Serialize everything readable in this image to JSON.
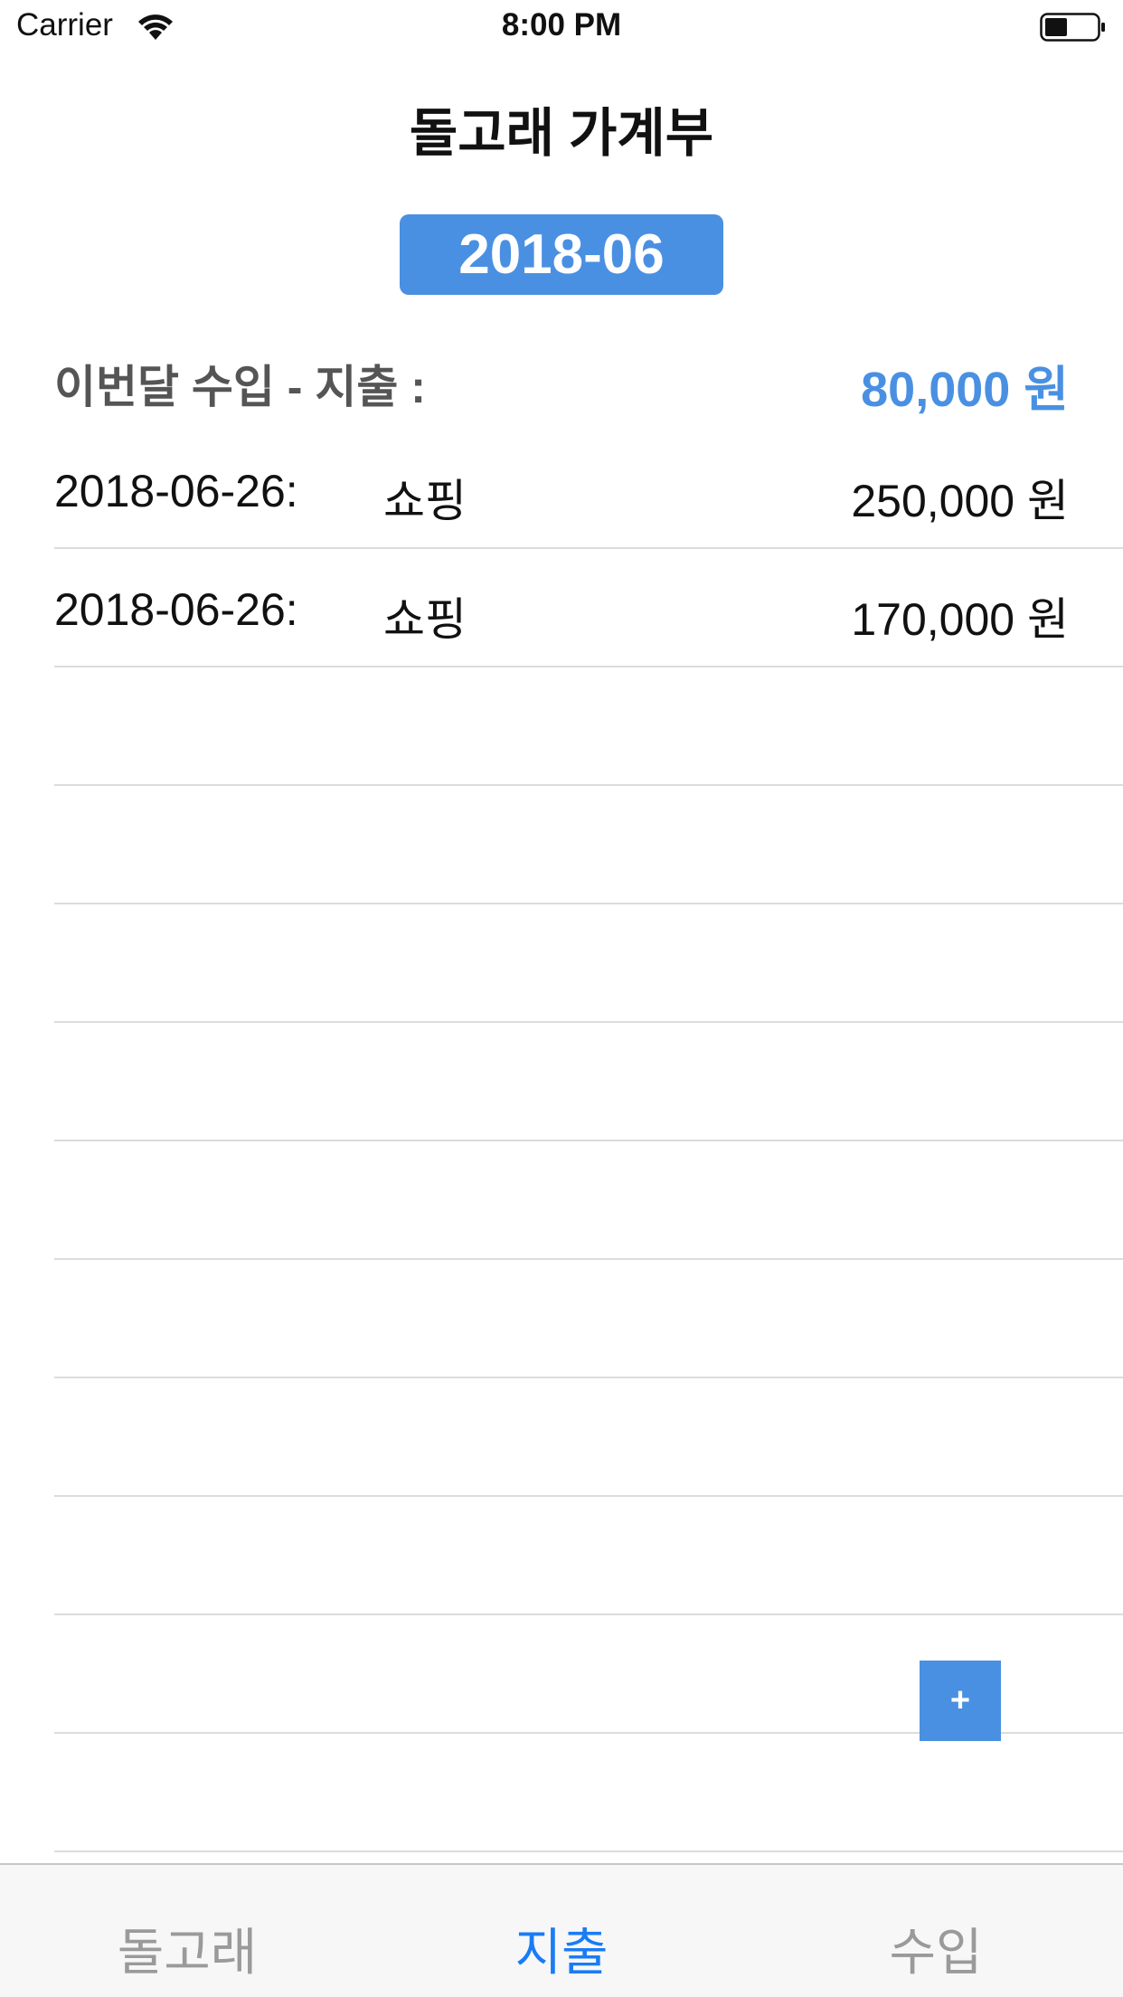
{
  "status_bar": {
    "carrier": "Carrier",
    "time": "8:00 PM",
    "wifi_icon": "wifi-icon",
    "battery_icon": "battery-icon"
  },
  "header": {
    "title": "돌고래 가계부"
  },
  "month_selector": {
    "label": "2018-06"
  },
  "summary": {
    "label": "이번달 수입 - 지출 :",
    "value": "80,000 원",
    "value_color": "#4a90e2"
  },
  "entries": [
    {
      "date": "2018-06-26:",
      "category": "쇼핑",
      "amount": "250,000 원"
    },
    {
      "date": "2018-06-26:",
      "category": "쇼핑",
      "amount": "170,000 원"
    },
    {
      "date": "",
      "category": "",
      "amount": ""
    },
    {
      "date": "",
      "category": "",
      "amount": ""
    },
    {
      "date": "",
      "category": "",
      "amount": ""
    },
    {
      "date": "",
      "category": "",
      "amount": ""
    },
    {
      "date": "",
      "category": "",
      "amount": ""
    },
    {
      "date": "",
      "category": "",
      "amount": ""
    },
    {
      "date": "",
      "category": "",
      "amount": ""
    },
    {
      "date": "",
      "category": "",
      "amount": ""
    },
    {
      "date": "",
      "category": "",
      "amount": ""
    },
    {
      "date": "",
      "category": "",
      "amount": ""
    },
    {
      "date": "",
      "category": "",
      "amount": ""
    }
  ],
  "add_button": {
    "label": "+"
  },
  "tab_bar": {
    "tabs": [
      {
        "label": "돌고래",
        "active": false
      },
      {
        "label": "지출",
        "active": true
      },
      {
        "label": "수입",
        "active": false
      }
    ],
    "active_color": "#1a7cf5",
    "inactive_color": "#9a9a9a"
  }
}
